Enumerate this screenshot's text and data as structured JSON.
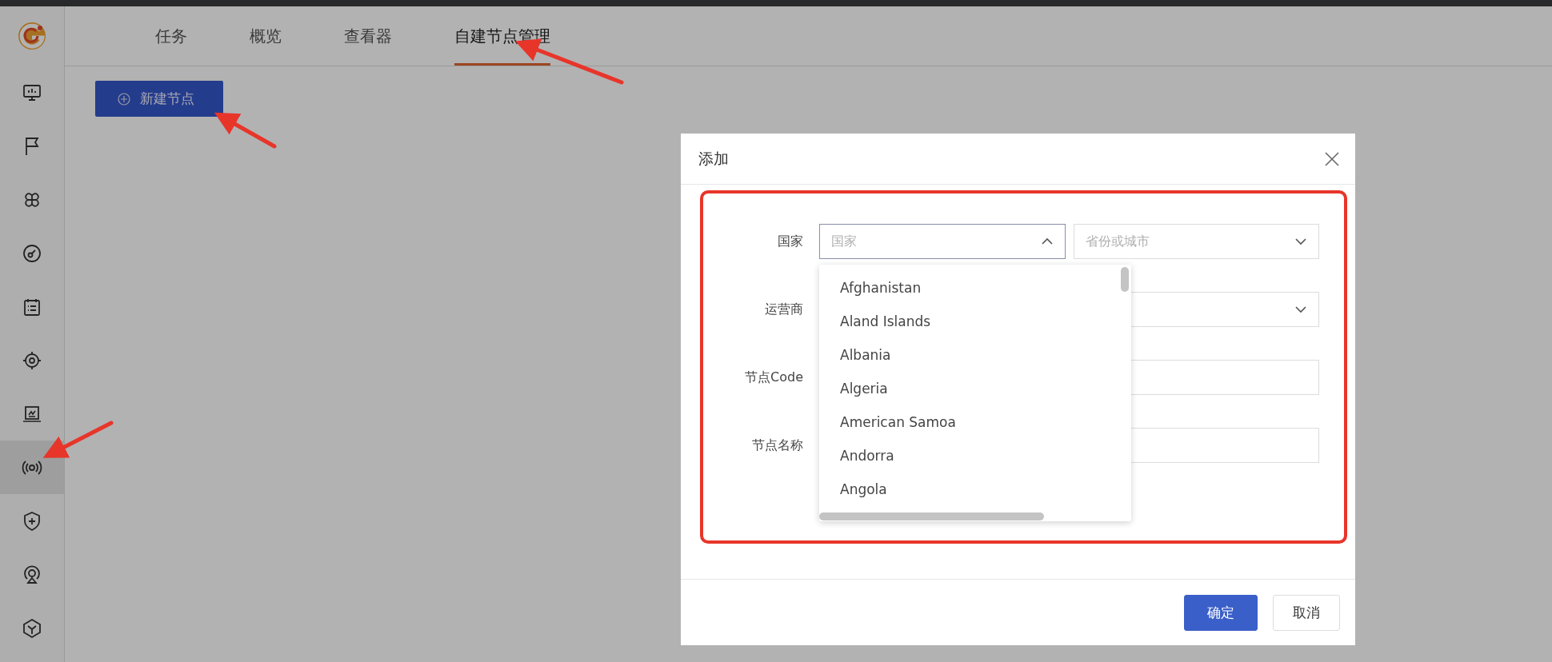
{
  "sidebar": {
    "items": [
      {
        "selected": false
      },
      {
        "selected": false
      },
      {
        "selected": false
      },
      {
        "selected": false
      },
      {
        "selected": false
      },
      {
        "selected": false
      },
      {
        "selected": false
      },
      {
        "selected": true
      },
      {
        "selected": false
      },
      {
        "selected": false
      },
      {
        "selected": false
      }
    ]
  },
  "tabs": [
    {
      "label": "任务",
      "selected": false
    },
    {
      "label": "概览",
      "selected": false
    },
    {
      "label": "查看器",
      "selected": false
    },
    {
      "label": "自建节点管理",
      "selected": true
    }
  ],
  "new_button": {
    "label": "新建节点"
  },
  "dialog": {
    "title": "添加",
    "rows": [
      {
        "label": "国家",
        "kind": "select-pair",
        "fields": [
          {
            "placeholder": "国家",
            "expanded": true
          },
          {
            "placeholder": "省份或城市",
            "expanded": false
          }
        ]
      },
      {
        "label": "运营商",
        "kind": "select",
        "fields": [
          {
            "expanded": false
          }
        ]
      },
      {
        "label": "节点Code",
        "kind": "input"
      },
      {
        "label": "节点名称",
        "kind": "input"
      }
    ],
    "options": [
      "Afghanistan",
      "Aland Islands",
      "Albania",
      "Algeria",
      "American Samoa",
      "Andorra",
      "Angola"
    ],
    "buttons": [
      {
        "label": "确定",
        "kind": "primary"
      },
      {
        "label": "取消",
        "kind": "default"
      }
    ]
  }
}
